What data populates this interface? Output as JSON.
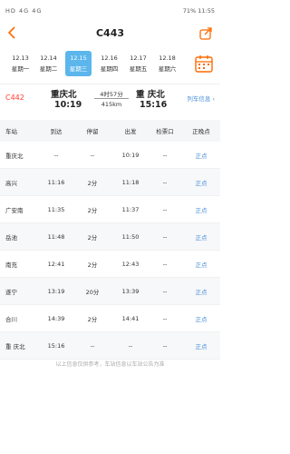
{
  "status_bar": {
    "left": "HD 4G 4G",
    "right": "71% 11:55"
  },
  "header": {
    "title": "C443"
  },
  "dates": [
    {
      "date": "12.13",
      "weekday": "星期一"
    },
    {
      "date": "12.14",
      "weekday": "星期二"
    },
    {
      "date": "12.15",
      "weekday": "星期三",
      "active": true
    },
    {
      "date": "12.16",
      "weekday": "星期四"
    },
    {
      "date": "12.17",
      "weekday": "星期五"
    },
    {
      "date": "12.18",
      "weekday": "星期六"
    }
  ],
  "trip": {
    "train_no": "C442",
    "from": "重庆北",
    "from_time": "10:19",
    "duration": "4时57分",
    "distance": "415km",
    "to": "重 庆北",
    "to_time": "15:16",
    "info_link": "列车信息 ›"
  },
  "table": {
    "headers": [
      "车站",
      "到达",
      "停留",
      "出发",
      "检票口",
      "正晚点"
    ],
    "rows": [
      [
        "重庆北",
        "--",
        "--",
        "10:19",
        "--",
        "正点"
      ],
      [
        "高兴",
        "11:16",
        "2分",
        "11:18",
        "--",
        "正点"
      ],
      [
        "广安南",
        "11:35",
        "2分",
        "11:37",
        "--",
        "正点"
      ],
      [
        "岳池",
        "11:48",
        "2分",
        "11:50",
        "--",
        "正点"
      ],
      [
        "南充",
        "12:41",
        "2分",
        "12:43",
        "--",
        "正点"
      ],
      [
        "遂宁",
        "13:19",
        "20分",
        "13:39",
        "--",
        "正点"
      ],
      [
        "合川",
        "14:39",
        "2分",
        "14:41",
        "--",
        "正点"
      ],
      [
        "重 庆北",
        "15:16",
        "--",
        "--",
        "--",
        "正点"
      ]
    ]
  },
  "footer_note": "以上信息仅供参考，车站信息以车站公告为准",
  "colors": {
    "accent": "#ff6a00",
    "date_active": "#5bb6ec",
    "link": "#4a90d9",
    "train_no": "#ff3b30"
  },
  "icons": {
    "back": "chevron-left-icon",
    "share": "share-icon",
    "calendar": "calendar-icon"
  }
}
